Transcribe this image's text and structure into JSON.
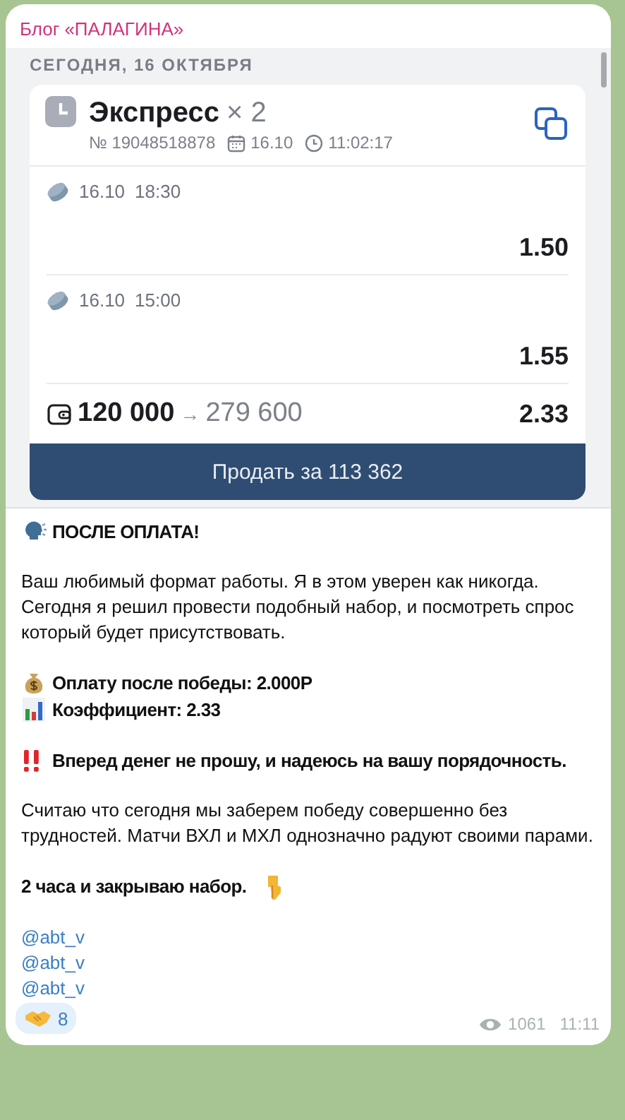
{
  "channel": {
    "name": "Блог «ПАЛАГИНА»"
  },
  "bet_screenshot": {
    "date_header": "СЕГОДНЯ, 16 ОКТЯБРЯ",
    "title": "Экспресс",
    "multiplier": "× 2",
    "number": "№ 19048518878",
    "date": "16.10",
    "time": "11:02:17",
    "events": [
      {
        "date": "16.10",
        "time": "18:30",
        "odds": "1.50"
      },
      {
        "date": "16.10",
        "time": "15:00",
        "odds": "1.55"
      }
    ],
    "stake": "120 000",
    "arrow": "→",
    "payout": "279 600",
    "total_odds": "2.33",
    "sell_button": "Продать за 113 362"
  },
  "message": {
    "blocks": [
      [
        {
          "kind": "speech",
          "text": "ПОСЛЕ ОПЛАТА!"
        }
      ],
      [
        {
          "kind": "plain",
          "text": "Ваш любимый формат работы. Я в этом уверен как никогда. Сегодня я решил провести подобный набор, и посмотреть спрос который будет присутствовать."
        }
      ],
      [
        {
          "kind": "money",
          "text": "Оплату после победы: 2.000Р"
        },
        {
          "kind": "chart",
          "text": "Коэффициент: 2.33"
        }
      ],
      [
        {
          "kind": "alert",
          "text": "Вперед денег не прошу, и надеюсь на вашу порядочность."
        }
      ],
      [
        {
          "kind": "plain",
          "text": "Считаю что сегодня мы заберем победу совершенно без трудностей. Матчи ВХЛ и МХЛ однозначно радуют своими парами."
        }
      ],
      [
        {
          "kind": "pointing",
          "text": "2 часа и закрываю набор."
        }
      ],
      [
        {
          "kind": "link",
          "text": "@abt_v"
        },
        {
          "kind": "link",
          "text": "@abt_v"
        },
        {
          "kind": "link",
          "text": "@abt_v"
        }
      ]
    ],
    "reactions": [
      {
        "kind": "handshake",
        "count": "8"
      }
    ],
    "views": "1061",
    "time": "11:11"
  }
}
